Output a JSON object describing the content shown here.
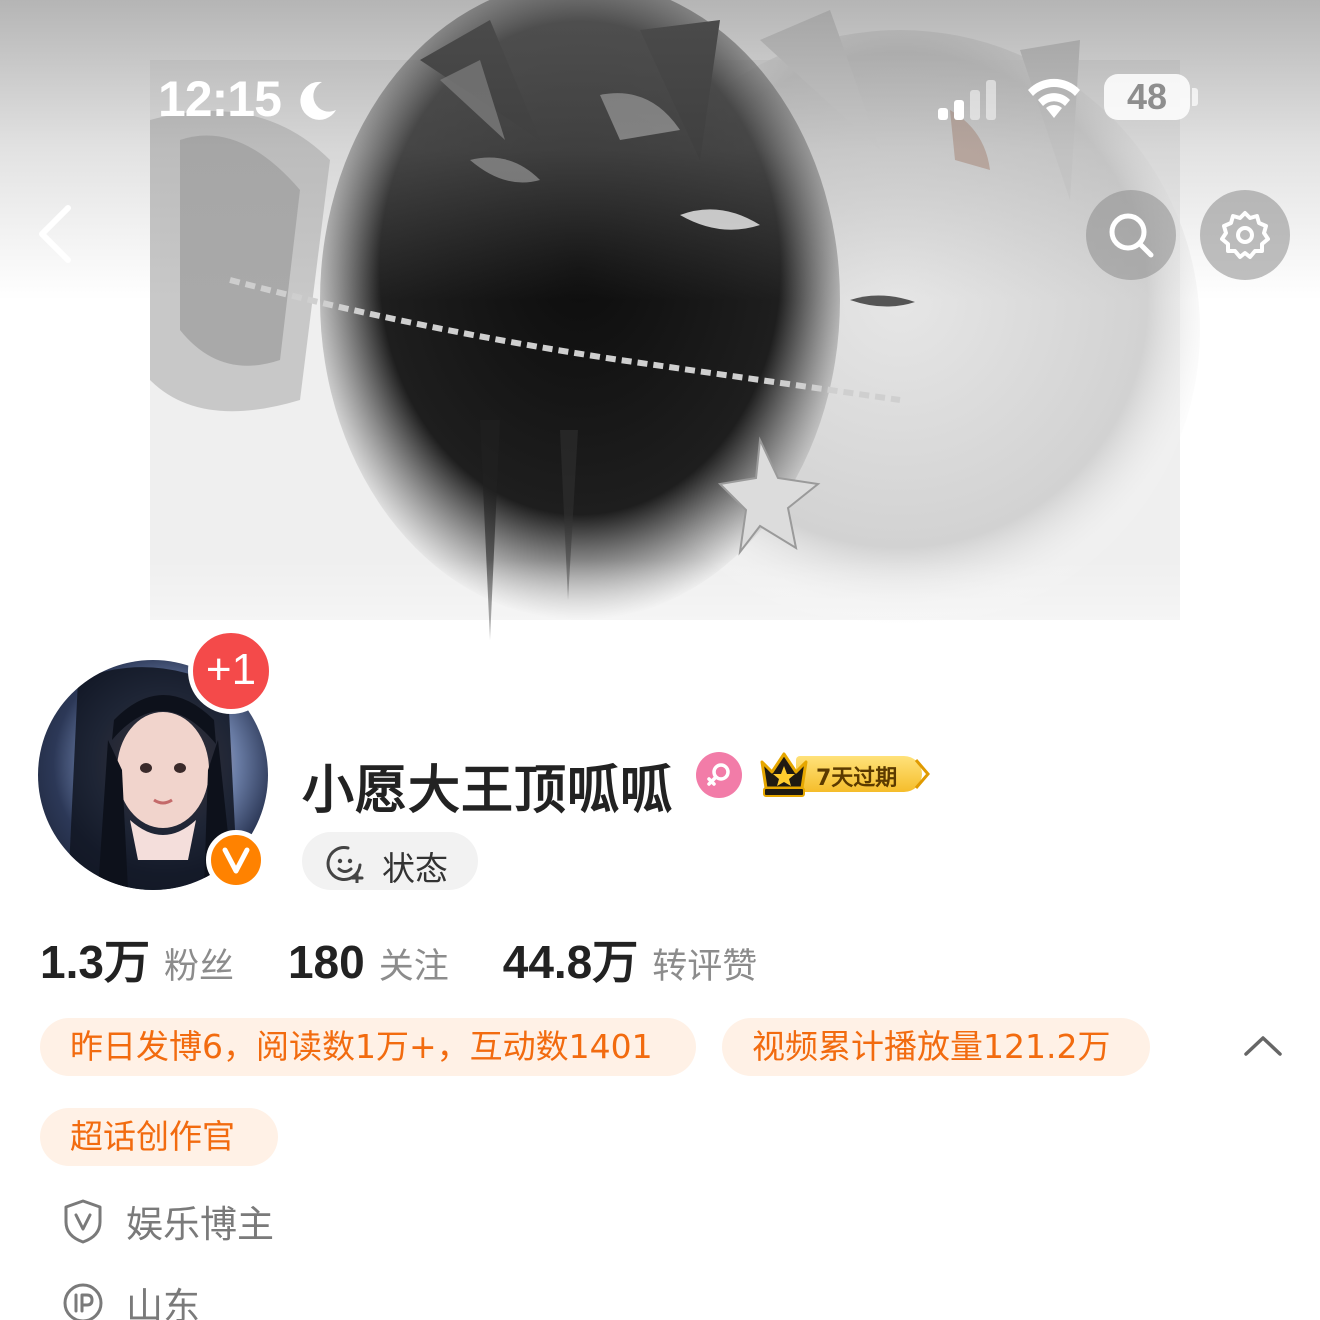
{
  "status_bar": {
    "time": "12:15",
    "battery": "48",
    "icons": [
      "moon-icon",
      "signal-icon",
      "wifi-icon",
      "battery-icon"
    ]
  },
  "nav": {
    "icons": [
      "back-arrow-icon",
      "search-icon",
      "gear-icon"
    ]
  },
  "profile": {
    "notification_badge": "+1",
    "username": "小愿大王顶呱呱",
    "vip_label": "7天过期",
    "status_label": "状态",
    "icons": [
      "female-gender-icon",
      "crown-icon",
      "verified-v-icon",
      "smiley-add-icon"
    ]
  },
  "stats": [
    {
      "value": "1.3万",
      "label": "粉丝"
    },
    {
      "value": "180",
      "label": "关注"
    },
    {
      "value": "44.8万",
      "label": "转评赞"
    }
  ],
  "tags": [
    "昨日发博6，阅读数1万+，互动数1401",
    "视频累计播放量121.2万",
    "超话创作官"
  ],
  "info": {
    "category": "娱乐博主",
    "ip_location": "山东"
  },
  "colors": {
    "accent_orange": "#f26b0f",
    "tag_bg": "#fff1e6",
    "badge_red": "#f44a4a",
    "verified_orange": "#ff8200",
    "gender_pink": "#f27ca8"
  }
}
